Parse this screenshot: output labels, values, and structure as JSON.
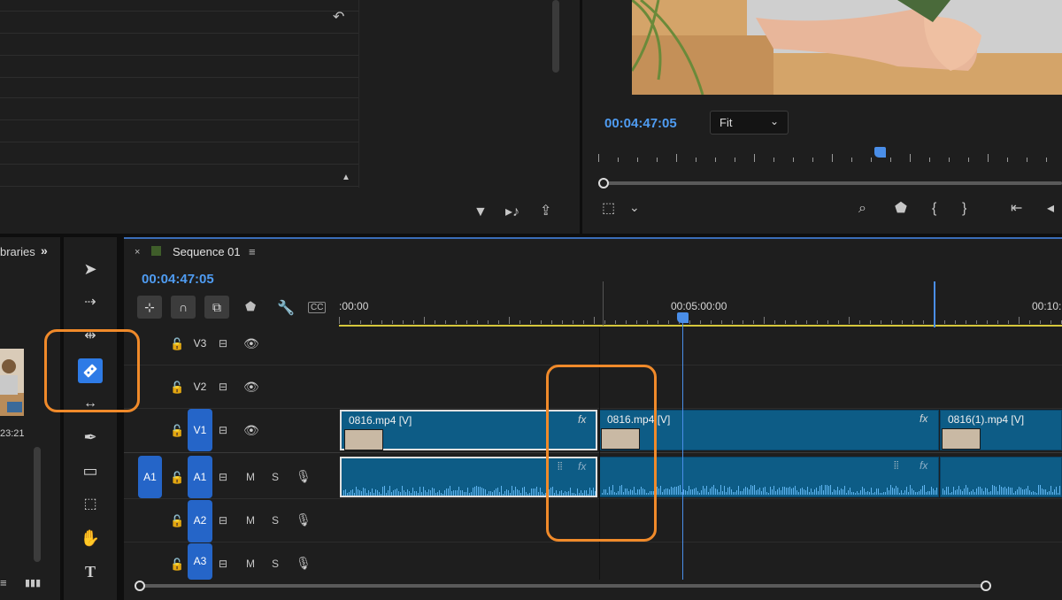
{
  "top_left_panel": {
    "reset_icon": "undo-icon",
    "bottom_icons": [
      "filter-icon",
      "insert-icon",
      "export-icon"
    ]
  },
  "program_monitor": {
    "timecode": "00:04:47:05",
    "zoom_select": "Fit",
    "buttons": [
      "safe-margins-icon",
      "chevron-down-icon",
      "export-frame-icon",
      "marker-icon",
      "mark-in-icon",
      "mark-out-icon",
      "go-to-in-icon",
      "step-back-icon"
    ]
  },
  "project_panel": {
    "tab_label": "braries",
    "overflow": "»",
    "duration": "23:21"
  },
  "timeline": {
    "sequence_name": "Sequence 01",
    "close": "×",
    "menu": "≡",
    "timecode": "00:04:47:05",
    "ruler_labels": [
      ":00:00",
      "00:05:00:00",
      "00:10:"
    ],
    "tracks": {
      "video": [
        {
          "name": "V3",
          "toggle_sync": "sync-lock-icon",
          "visible": true
        },
        {
          "name": "V2",
          "toggle_sync": "sync-lock-icon",
          "visible": true
        },
        {
          "name": "V1",
          "toggle_sync": "sync-lock-icon",
          "visible": true,
          "targeted": true
        }
      ],
      "audio": [
        {
          "source": "A1",
          "name": "A1",
          "mute": "M",
          "solo": "S",
          "targeted": true
        },
        {
          "name": "A2",
          "mute": "M",
          "solo": "S"
        },
        {
          "name": "A3",
          "mute": "M",
          "solo": "S"
        }
      ]
    },
    "clips": {
      "v1": [
        {
          "title": "0816.mp4 [V]",
          "fx": "fx"
        },
        {
          "title": "0816.mp4 [V]",
          "fx": "fx"
        },
        {
          "title": "0816(1).mp4 [V]",
          "fx": ""
        }
      ],
      "a1_fx": "fx"
    }
  },
  "colors": {
    "accent_blue": "#2e7be6",
    "timecode_blue": "#4f9cf2",
    "clip_teal": "#0d5c86",
    "annotation_orange": "#f08a2a",
    "work_area_yellow": "#d5c73c"
  }
}
